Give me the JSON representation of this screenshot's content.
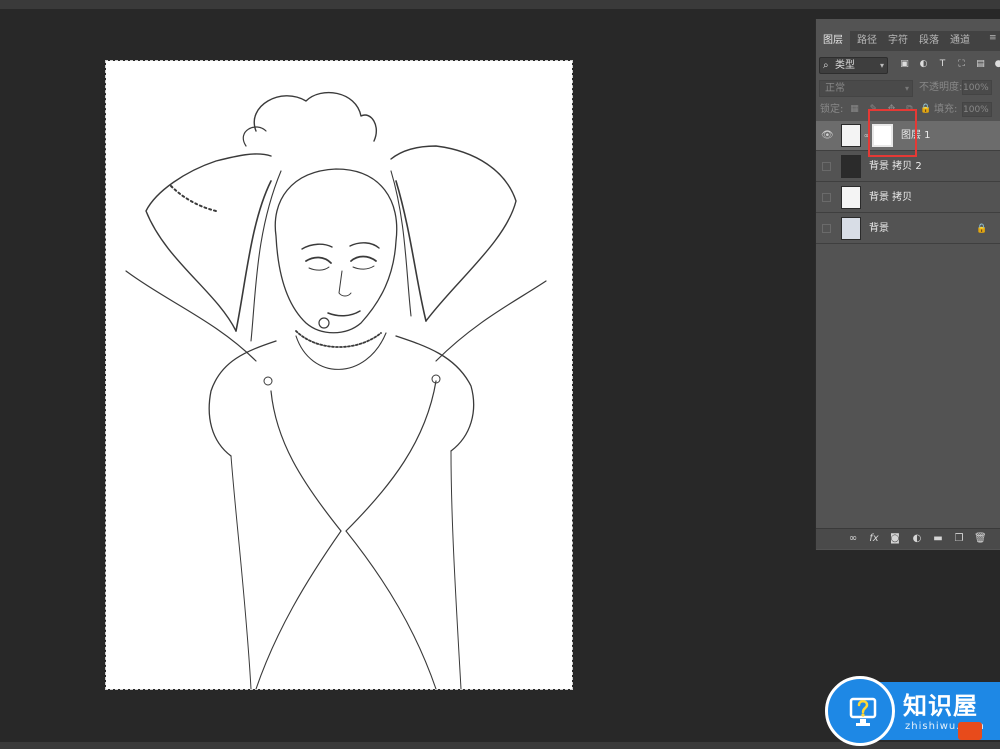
{
  "layers_panel": {
    "tabs": [
      "图层",
      "路径",
      "字符",
      "段落",
      "通道"
    ],
    "active_tab": "图层",
    "filter": {
      "kind_label": "类型"
    },
    "blend_mode": "正常",
    "opacity_label": "不透明度:",
    "opacity_value": "100%",
    "lock_label": "锁定:",
    "fill_label": "填充:",
    "fill_value": "100%",
    "layers": [
      {
        "name": "图层 1",
        "selected": true,
        "visible": true,
        "has_mask": true,
        "thumb": "sketch"
      },
      {
        "name": "背景 拷贝 2",
        "selected": false,
        "visible": false,
        "thumb": "dark-photo"
      },
      {
        "name": "背景 拷贝",
        "selected": false,
        "visible": false,
        "thumb": "sketch"
      },
      {
        "name": "背景",
        "selected": false,
        "visible": false,
        "locked": true,
        "thumb": "photo"
      }
    ]
  },
  "watermark": {
    "title": "知识屋",
    "subtitle": "zhishiwu.com",
    "brand_color": "#1e88e5"
  },
  "colors": {
    "workspace_bg": "#282828",
    "panel_bg": "#535353",
    "selected_row": "#6c6c6c",
    "highlight_box": "#e53935"
  }
}
